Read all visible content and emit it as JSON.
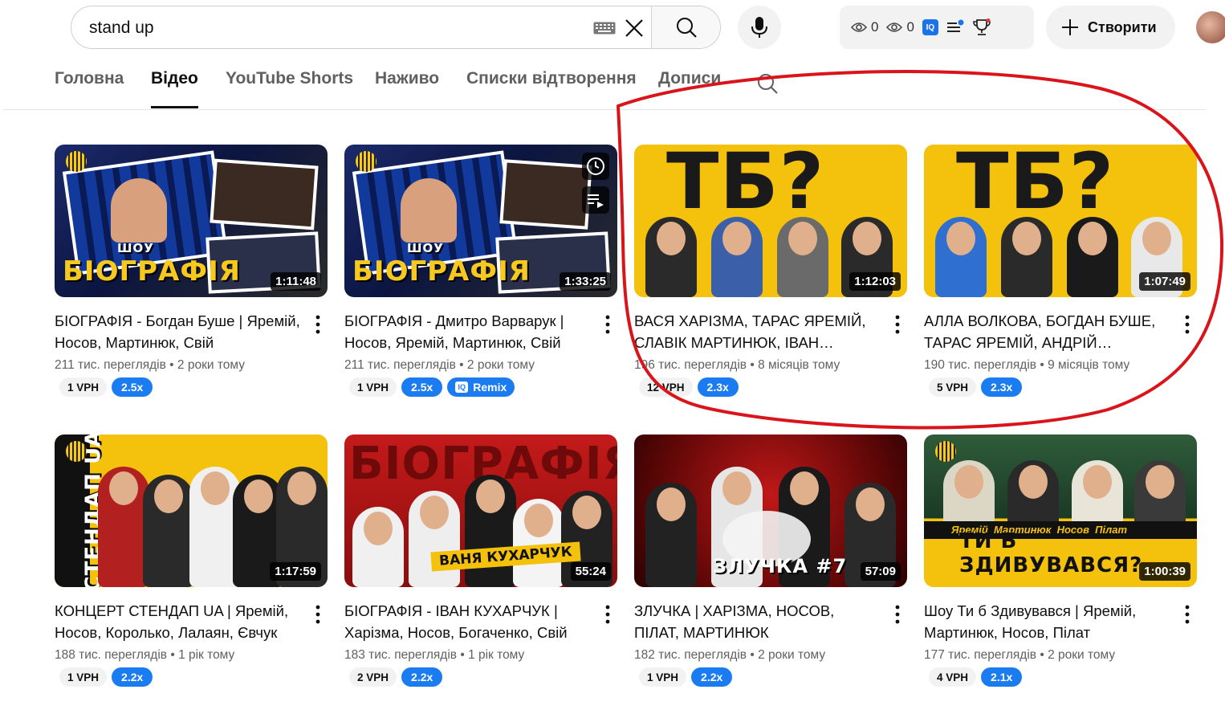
{
  "search": {
    "query": "stand up"
  },
  "header": {
    "ext_views_a": "0",
    "ext_views_b": "0",
    "ext_iq": "IQ",
    "create_label": "Створити"
  },
  "tabs": [
    {
      "label": "Головна"
    },
    {
      "label": "Відео"
    },
    {
      "label": "YouTube Shorts"
    },
    {
      "label": "Наживо"
    },
    {
      "label": "Списки відтворення"
    },
    {
      "label": "Дописи"
    }
  ],
  "videos": [
    {
      "title": "БІОГРАФІЯ - Богдан Буше | Яремій, Носов, Мартинюк, Свій",
      "duration": "1:11:48",
      "views": "211 тис. переглядів",
      "age": "2 роки тому",
      "vph": "1 VPH",
      "mult": "2.5x",
      "thumb_text": "БІОГРАФІЯ",
      "thumb_sub": "ШОУ"
    },
    {
      "title": "БІОГРАФІЯ - Дмитро Варварук | Носов, Яремій, Мартинюк, Свій",
      "duration": "1:33:25",
      "views": "211 тис. переглядів",
      "age": "2 роки тому",
      "vph": "1 VPH",
      "mult": "2.5x",
      "remix": "Remix",
      "thumb_text": "БІОГРАФІЯ",
      "thumb_sub": "ШОУ"
    },
    {
      "title": "ВАСЯ ХАРІЗМА, ТАРАС ЯРЕМІЙ, СЛАВІК МАРТИНЮК, ІВАН КАЗАРКІН",
      "duration": "1:12:03",
      "views": "196 тис. переглядів",
      "age": "8 місяців тому",
      "vph": "12 VPH",
      "mult": "2.3x",
      "thumb_text": "ТБ?"
    },
    {
      "title": "АЛЛА ВОЛКОВА, БОГДАН БУШЕ, ТАРАС ЯРЕМІЙ, АНДРІЙ БЕРЕЖКО",
      "duration": "1:07:49",
      "views": "190 тис. переглядів",
      "age": "9 місяців тому",
      "vph": "5 VPH",
      "mult": "2.3x",
      "thumb_text": "ТБ?"
    },
    {
      "title": "КОНЦЕРТ СТЕНДАП UA | Яремій, Носов, Королько, Лалаян, Євчук",
      "duration": "1:17:59",
      "views": "188 тис. переглядів",
      "age": "1 рік тому",
      "vph": "1 VPH",
      "mult": "2.2x",
      "thumb_text": "СТЕНДАП UA"
    },
    {
      "title": "БІОГРАФІЯ - ІВАН КУХАРЧУК | Харізма, Носов, Богаченко, Свій",
      "duration": "55:24",
      "views": "183 тис. переглядів",
      "age": "1 рік тому",
      "vph": "2 VPH",
      "mult": "2.2x",
      "thumb_text": "ВАНЯ КУХАРЧУК",
      "thumb_sub": "БІОГРАФІЯ"
    },
    {
      "title": "ЗЛУЧКА | ХАРІЗМА, НОСОВ, ПІЛАТ, МАРТИНЮК",
      "duration": "57:09",
      "views": "182 тис. переглядів",
      "age": "2 роки тому",
      "vph": "1 VPH",
      "mult": "2.2x",
      "thumb_text": "ЗЛУЧКА #7"
    },
    {
      "title": "Шоу Ти б Здивувався | Яремій, Мартинюк, Носов, Пілат",
      "duration": "1:00:39",
      "views": "177 тис. переглядів",
      "age": "2 роки тому",
      "vph": "4 VPH",
      "mult": "2.1x",
      "thumb_text": "ТИ Б ЗДИВУВАВСЯ?",
      "thumb_sub": "Яремій  Мартинюк  Носов  Пілат"
    }
  ],
  "colors": {
    "accent": "#1a7cf0",
    "annotation": "#d9141b"
  }
}
